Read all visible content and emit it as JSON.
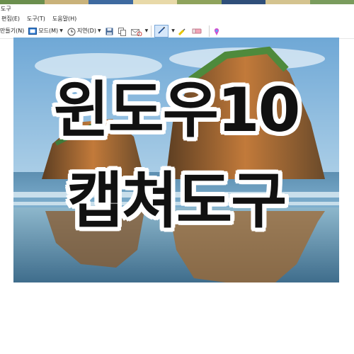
{
  "title_bar": {
    "text": "도구"
  },
  "menu": {
    "items": [
      "편집(E)",
      "도구(T)",
      "도움말(H)"
    ]
  },
  "toolbar": {
    "new_label": "만들기(N)",
    "mode_label": "모드(M)",
    "delay_label": "지연(D)"
  },
  "overlay": {
    "line1": "윈도우10",
    "line2": "캡쳐도구"
  }
}
